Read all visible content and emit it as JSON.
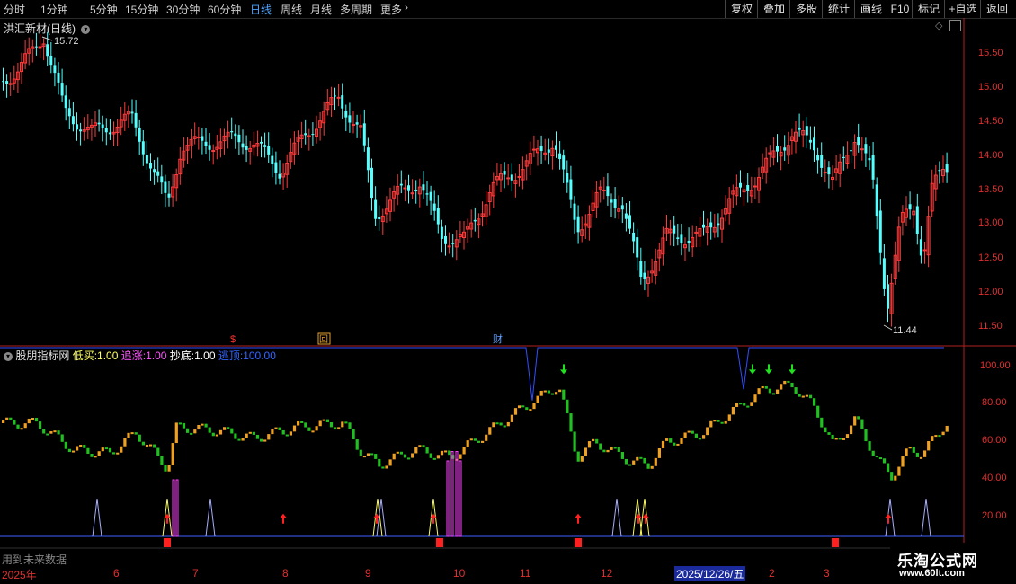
{
  "toolbar": {
    "periods": [
      "分时",
      "1分钟",
      "5分钟",
      "15分钟",
      "30分钟",
      "60分钟",
      "日线",
      "周线",
      "月线",
      "多周期",
      "更多"
    ],
    "active_period": "日线",
    "more_arrow": "chevron-right-icon",
    "right_buttons": [
      "复权",
      "叠加",
      "多股",
      "统计",
      "画线",
      "F10",
      "标记",
      "+自选",
      "返回"
    ]
  },
  "main_chart": {
    "title": "洪汇新材(日线)",
    "high_label": "15.72",
    "low_label": "11.44",
    "price_axis": [
      "15.50",
      "15.00",
      "14.50",
      "14.00",
      "13.50",
      "13.00",
      "12.50",
      "12.00",
      "11.50"
    ],
    "markers": [
      "$",
      "回",
      "财"
    ],
    "colors": {
      "up": "#ff3b3b",
      "down": "#54ffff",
      "axis": "#e03030"
    }
  },
  "indicator": {
    "name": "股朋指标网",
    "params": [
      {
        "label": "低买:",
        "value": "1.00",
        "color": "#ffff66"
      },
      {
        "label": "追涨:",
        "value": "1.00",
        "color": "#ff55ff"
      },
      {
        "label": "抄底:",
        "value": "1.00",
        "color": "#ffffff"
      },
      {
        "label": "逃顶:",
        "value": "100.00",
        "color": "#3366ff"
      }
    ],
    "axis": [
      "100.00",
      "80.00",
      "60.00",
      "40.00",
      "20.00"
    ],
    "footer_text": "用到未来数据",
    "colors": {
      "up": "#f0a020",
      "down": "#20c020",
      "top_line": "#2f4fff",
      "buy_arrow": "#ff2020",
      "sell_arrow": "#20e020"
    }
  },
  "date_axis": {
    "labels": [
      "2025年",
      "6",
      "7",
      "8",
      "9",
      "10",
      "11",
      "12",
      "2025/12/26/五",
      "2",
      "3"
    ],
    "highlight": "2025/12/26/五"
  },
  "watermark": {
    "line1": "乐淘公式网",
    "line2": "www.60lt.com"
  }
}
